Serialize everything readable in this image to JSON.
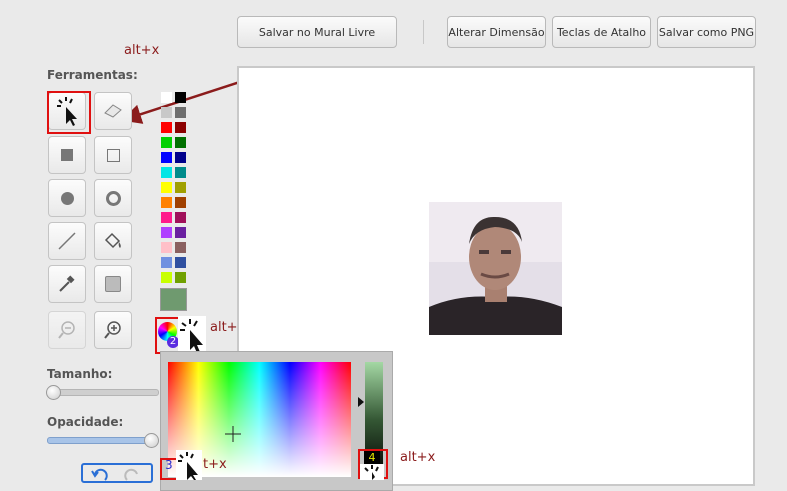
{
  "toolbar": {
    "save_mural": "Salvar no Mural Livre",
    "change_size": "Alterar Dimensão",
    "shortcuts": "Teclas de Atalho",
    "save_png": "Salvar como PNG"
  },
  "annotations": {
    "alt_top": "alt+x",
    "alt_color": "alt+x",
    "alt_bottom_left": "t+x",
    "alt_bottom_right": "alt+x",
    "color_badge": "2",
    "bottom_badge": "3",
    "gradient_badge": "4"
  },
  "labels": {
    "tools": "Ferramentas:",
    "size": "Tamanho:",
    "opacity": "Opacidade:"
  },
  "palette_colors": [
    [
      "#ffffff",
      "#000000"
    ],
    [
      "#c8c8c8",
      "#6e6e6e"
    ],
    [
      "#ff0000",
      "#8b0000"
    ],
    [
      "#00d000",
      "#007000"
    ],
    [
      "#0000ff",
      "#00008b"
    ],
    [
      "#00e5e5",
      "#008b8b"
    ],
    [
      "#ffff00",
      "#a0a000"
    ],
    [
      "#ff8000",
      "#a04000"
    ],
    [
      "#ff1a8c",
      "#a0105a"
    ],
    [
      "#b040ff",
      "#6a20a0"
    ],
    [
      "#ffc0c8",
      "#8a6060"
    ],
    [
      "#7090e0",
      "#3050a0"
    ],
    [
      "#c8ff00",
      "#70a000"
    ]
  ],
  "current_color": "#6f9a6f",
  "accent": "#e01010"
}
